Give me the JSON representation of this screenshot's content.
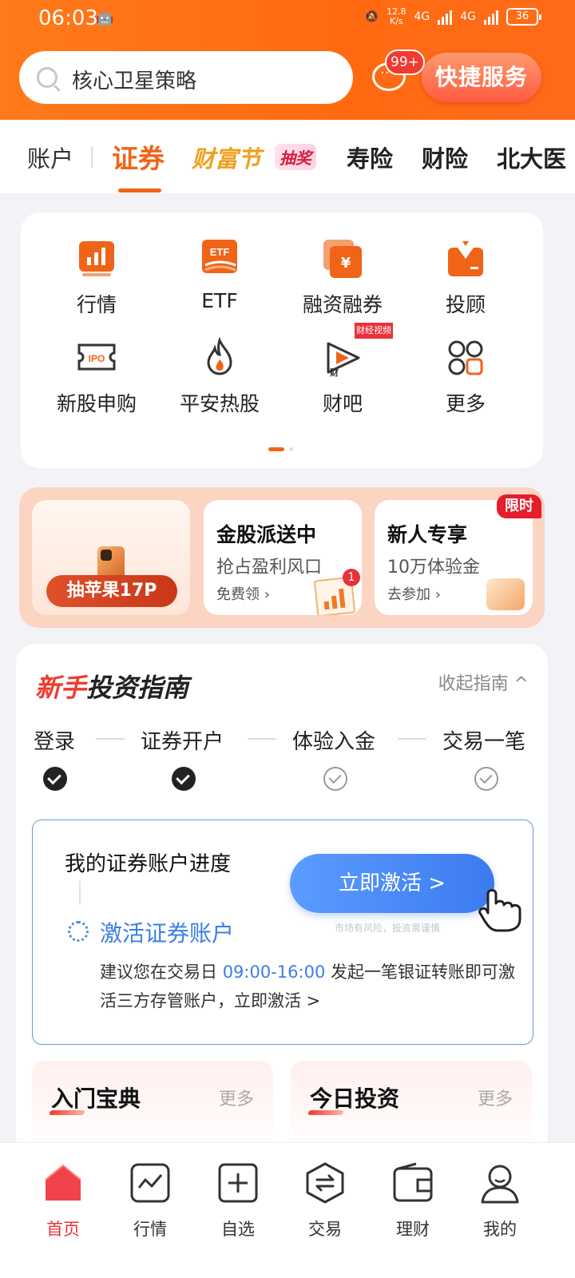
{
  "status": {
    "time": "06:03",
    "speed_value": "12.8",
    "speed_unit": "K/s",
    "net1": "4G",
    "net2": "4G",
    "battery": "36"
  },
  "header": {
    "search_text": "核心卫星策略",
    "message_badge": "99+",
    "quick_service": "快捷服务"
  },
  "tabs": {
    "account": "账户",
    "securities": "证券",
    "festival": "财富节",
    "lottery": "抽奖",
    "life": "寿险",
    "property": "财险",
    "pku": "北大医"
  },
  "grid": [
    {
      "label": "行情",
      "icon": "market-chart-icon"
    },
    {
      "label": "ETF",
      "icon": "etf-icon"
    },
    {
      "label": "融资融券",
      "icon": "margin-trading-icon"
    },
    {
      "label": "投顾",
      "icon": "advisor-icon"
    },
    {
      "label": "新股申购",
      "icon": "ipo-ticket-icon"
    },
    {
      "label": "平安热股",
      "icon": "flame-icon"
    },
    {
      "label": "财吧",
      "icon": "finance-forum-icon"
    },
    {
      "label": "更多",
      "icon": "more-grid-icon"
    }
  ],
  "grid_tag": "财经视频",
  "promo": {
    "lottery_pill": "抽苹果17P",
    "card2": {
      "title": "金股派送中",
      "subtitle": "抢占盈利风口",
      "link": "免费领 ›",
      "badge": "1"
    },
    "card3": {
      "title": "新人专享",
      "subtitle": "10万体验金",
      "link": "去参加 ›",
      "limited": "限时"
    }
  },
  "guide": {
    "title_red": "新手",
    "title_black": "投资指南",
    "collapse": "收起指南 ^",
    "steps": [
      "登录",
      "证券开户",
      "体验入金",
      "交易一笔"
    ],
    "progress_title": "我的证券账户进度",
    "activate_title": "激活证券账户",
    "desc_before": "建议您在交易日 ",
    "desc_time": "09:00-16:00",
    "desc_after": " 发起一笔银证转账即可激活三方存管账户，立即激活 >",
    "activate_button": "立即激活 >",
    "risk_note": "市场有风险，投资需谨慎",
    "mini1_title": "入门宝典",
    "mini2_title": "今日投资",
    "more": "更多"
  },
  "bottom_nav": [
    "首页",
    "行情",
    "自选",
    "交易",
    "理财",
    "我的"
  ],
  "colors": {
    "brand_orange": "#f06418",
    "accent_red": "#e8323a",
    "link_blue": "#3c7ee6"
  }
}
